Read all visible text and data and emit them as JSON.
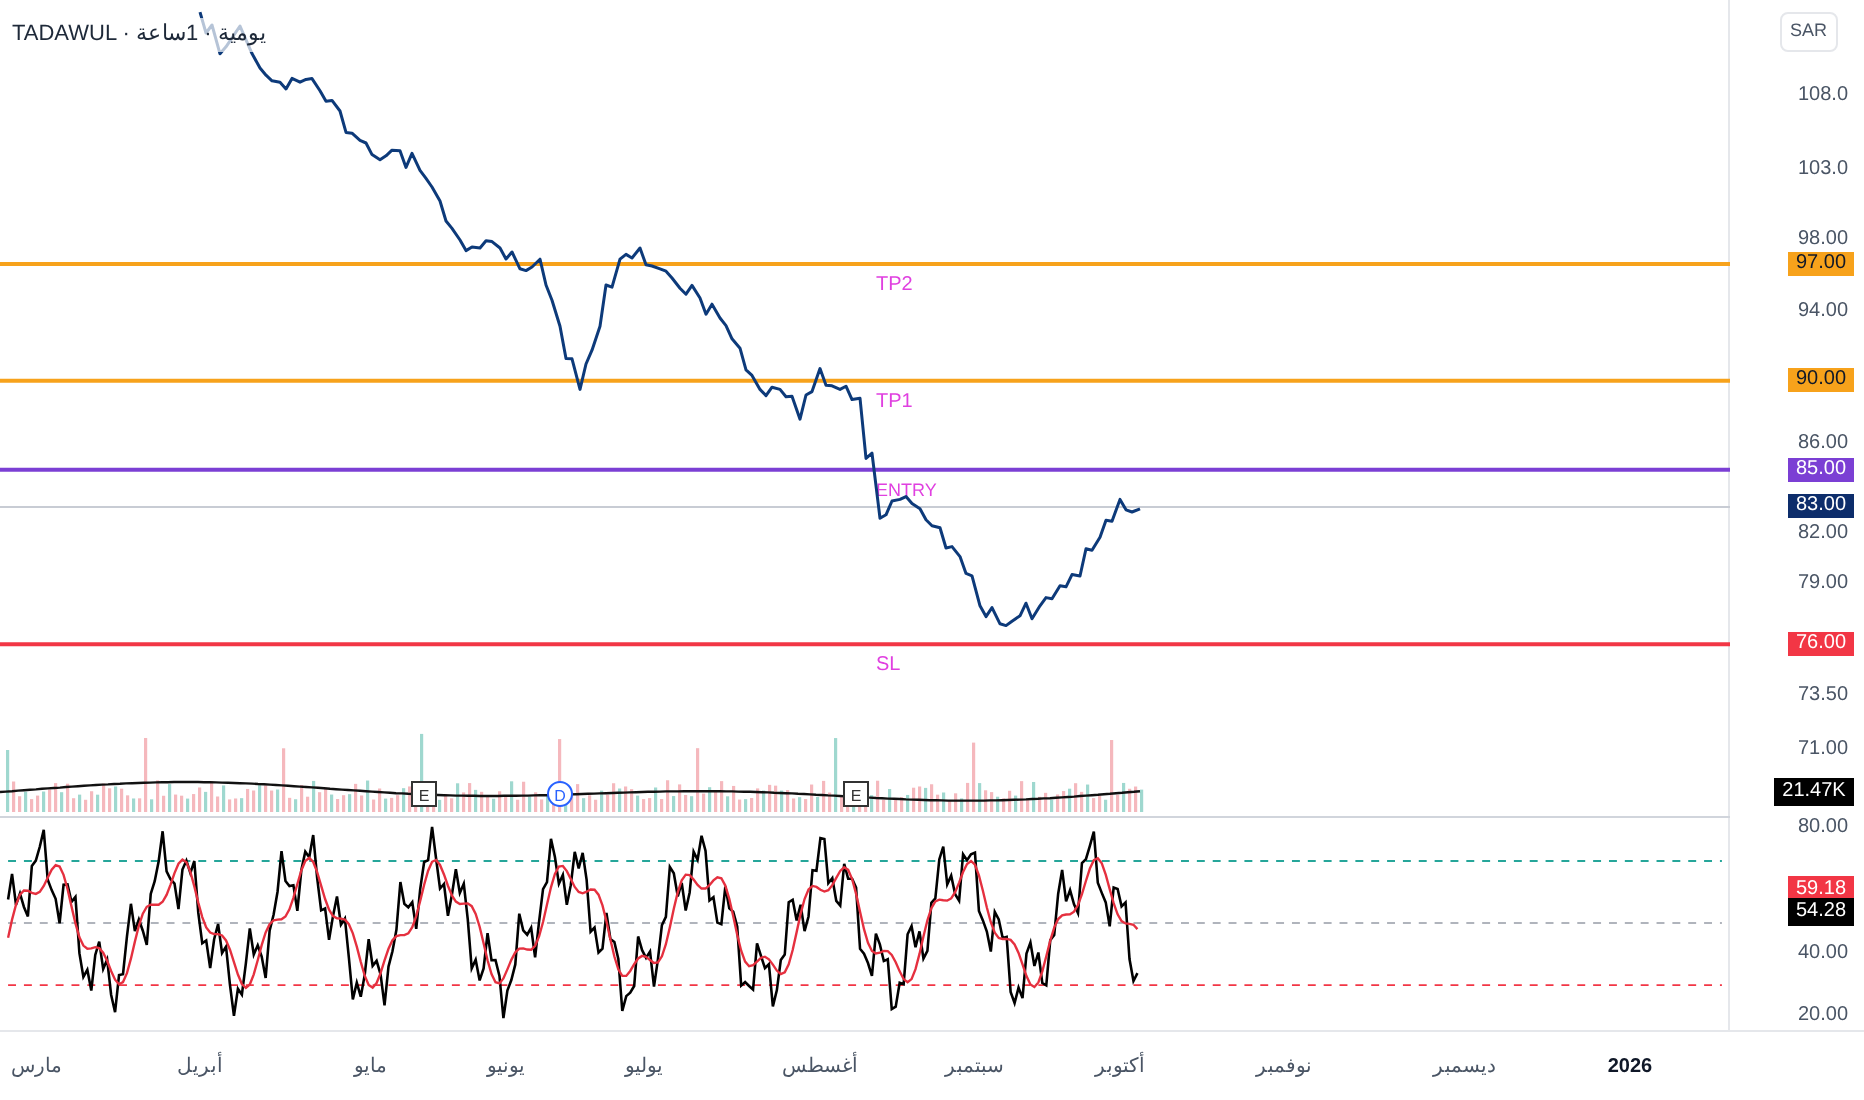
{
  "header": {
    "title": "TADAWUL · يومية · 1ساعة"
  },
  "currency": "SAR",
  "price_pane": {
    "axis": [
      "108.0",
      "103.0",
      "98.00",
      "94.00",
      "86.00",
      "82.00",
      "79.00",
      "73.50",
      "71.00"
    ]
  },
  "levels": [
    {
      "label": "TP2",
      "price": "97.00",
      "color": "#f7a21b"
    },
    {
      "label": "TP1",
      "price": "90.00",
      "color": "#f7a21b"
    },
    {
      "label": "ENTRY",
      "price": "85.00",
      "color": "#7b3fd4"
    },
    {
      "label": "SL",
      "price": "76.00",
      "color": "#f23645"
    }
  ],
  "last_price": {
    "price": "83.00"
  },
  "volume": {
    "value": "21.47K"
  },
  "events": [
    {
      "kind": "earnings",
      "label": "E"
    },
    {
      "kind": "dividend",
      "label": "D"
    },
    {
      "kind": "earnings",
      "label": "E"
    }
  ],
  "rsi_pane": {
    "axis": [
      "80.00",
      "40.00",
      "20.00"
    ],
    "tags": [
      {
        "value": "59.18",
        "color": "#f23645"
      },
      {
        "value": "54.28",
        "color": "#000000"
      }
    ]
  },
  "time_axis": [
    "2026",
    "ديسمبر",
    "نوفمبر",
    "أكتوبر",
    "سبتمبر",
    "أغسطس",
    "يوليو",
    "يونيو",
    "مايو",
    "أبريل",
    "مارس"
  ]
}
